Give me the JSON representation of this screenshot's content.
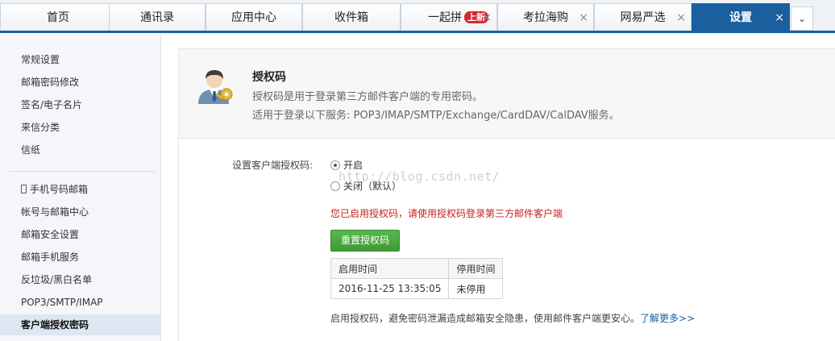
{
  "tabs": [
    {
      "label": "首页",
      "closable": false,
      "active": false
    },
    {
      "label": "通讯录",
      "closable": false,
      "active": false
    },
    {
      "label": "应用中心",
      "closable": false,
      "active": false
    },
    {
      "label": "收件箱",
      "closable": false,
      "active": false
    },
    {
      "label": "一起拼",
      "badge": "上新",
      "closable": true,
      "active": false
    },
    {
      "label": "考拉海购",
      "closable": true,
      "active": false
    },
    {
      "label": "网易严选",
      "closable": true,
      "active": false
    },
    {
      "label": "设置",
      "closable": true,
      "active": true
    }
  ],
  "close_glyph": "×",
  "more_glyph": "⌄",
  "sidebar": {
    "items": [
      {
        "label": "常规设置"
      },
      {
        "label": "邮箱密码修改"
      },
      {
        "label": "签名/电子名片"
      },
      {
        "label": "来信分类"
      },
      {
        "label": "信纸"
      },
      {
        "label": "手机号码邮箱",
        "icon": "phone-icon"
      },
      {
        "label": "帐号与邮箱中心"
      },
      {
        "label": "邮箱安全设置"
      },
      {
        "label": "邮箱手机服务"
      },
      {
        "label": "反垃圾/黑白名单"
      },
      {
        "label": "POP3/SMTP/IMAP"
      },
      {
        "label": "客户端授权密码",
        "active": true
      }
    ]
  },
  "header": {
    "title": "授权码",
    "line1": "授权码是用于登录第三方邮件客户端的专用密码。",
    "line2": "适用于登录以下服务: POP3/IMAP/SMTP/Exchange/CardDAV/CalDAV服务。",
    "icon": "user-key-icon"
  },
  "form": {
    "label": "设置客户端授权码:",
    "options": [
      {
        "label": "开启",
        "checked": true
      },
      {
        "label": "关闭（默认）",
        "checked": false
      }
    ],
    "notice": "您已启用授权码，请使用授权码登录第三方邮件客户端",
    "reset_button": "重置授权码"
  },
  "table": {
    "headers": [
      "启用时间",
      "停用时间"
    ],
    "rows": [
      [
        "2016-11-25 13:35:05",
        "未停用"
      ]
    ]
  },
  "tip": {
    "text": "启用授权码，避免密码泄漏造成邮箱安全隐患，使用邮件客户端更安心。",
    "link": "了解更多>>"
  },
  "watermark": "http://blog.csdn.net/",
  "colors": {
    "accent": "#1a5f9e",
    "notice": "#c8201b",
    "button": "#4aa83f",
    "badge": "#d6262e"
  }
}
